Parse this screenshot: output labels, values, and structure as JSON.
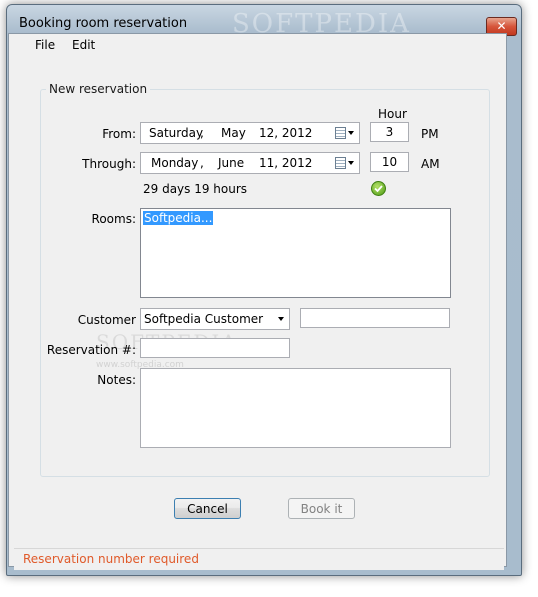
{
  "window": {
    "title": "Booking room reservation",
    "watermark": "SOFTPEDIA",
    "close_glyph": "✕"
  },
  "menu": {
    "items": [
      "File",
      "Edit"
    ]
  },
  "group": {
    "title": "New reservation"
  },
  "hour_header": "Hour",
  "from": {
    "label": "From:",
    "weekday": "Saturday",
    "month": "May",
    "day_year": "12, 2012",
    "hour": "3",
    "ampm": "PM"
  },
  "through": {
    "label": "Through:",
    "weekday": "Monday",
    "month": "June",
    "day_year": "11, 2012",
    "hour": "10",
    "ampm": "AM"
  },
  "date_separator": ",",
  "duration": "29 days 19 hours",
  "valid_icon": "check-icon",
  "rooms": {
    "label": "Rooms:",
    "items": [
      "Softpedia..."
    ]
  },
  "customer": {
    "label": "Customer",
    "selected": "Softpedia Customer",
    "extra_value": ""
  },
  "reservation_number": {
    "label": "Reservation #:",
    "value": ""
  },
  "notes": {
    "label": "Notes:",
    "value": ""
  },
  "buttons": {
    "cancel": "Cancel",
    "book": "Book it"
  },
  "status": {
    "text": "Reservation number required",
    "color": "#e05a2a"
  },
  "watermark_faint": {
    "text": "SOFTPEDIA",
    "url": "www.softpedia.com"
  }
}
